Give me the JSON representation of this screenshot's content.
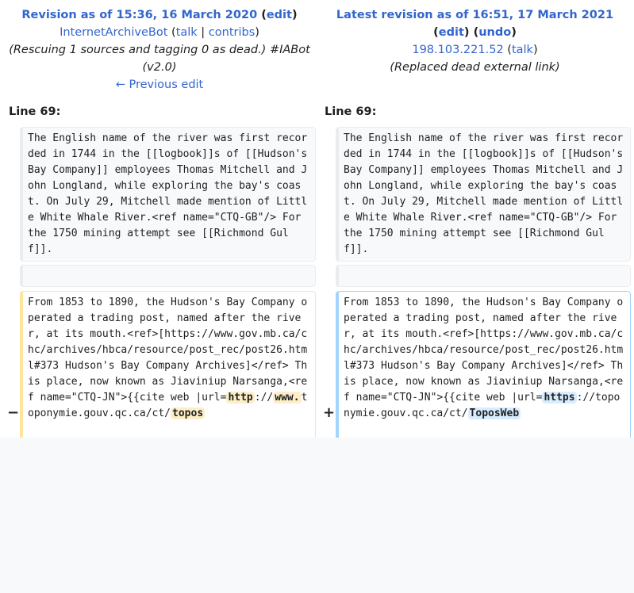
{
  "old_revision": {
    "title": "Revision as of 15:36, 16 March 2020",
    "edit_label": "edit",
    "user": "InternetArchiveBot",
    "talk_label": "talk",
    "contribs_label": "contribs",
    "summary": "(Rescuing 1 sources and tagging 0 as dead.) #IABot (v2.0)",
    "prev_edit_label": "← Previous edit",
    "line_label": "Line 69:"
  },
  "new_revision": {
    "title": "Latest revision as of 16:51, 17 March 2021",
    "edit_label": "edit",
    "undo_label": "undo",
    "user": "198.103.221.52",
    "talk_label": "talk",
    "summary": "(Replaced dead external link)",
    "line_label": "Line 69:"
  },
  "diff": {
    "context_paragraph": "The English name of the river was first recorded in 1744 in the [[logbook]]s of [[Hudson's Bay Company]] employees Thomas Mitchell and John Longland, while exploring the bay's coast. On July 29, Mitchell made mention of Little White Whale River.<ref name=\"CTQ-GB\"/> For the 1750 mining attempt see [[Richmond Gulf]].",
    "deleted_marker": "−",
    "added_marker": "+",
    "old_changed": {
      "prefix": "From 1853 to 1890, the Hudson's Bay Company operated a trading post, named after the river, at its mouth.<ref>[https://www.gov.mb.ca/chc/archives/hbca/resource/post_rec/post26.html#373 Hudson's Bay Company Archives]</ref> This place, now known as Jiaviniup Narsanga,<ref name=\"CTQ-JN\">{{cite web |url=",
      "seg1": "http",
      "mid1": "://",
      "seg2": "www.",
      "mid2": "toponymie.gouv.qc.ca/ct/",
      "seg3": "topos"
    },
    "new_changed": {
      "prefix": "From 1853 to 1890, the Hudson's Bay Company operated a trading post, named after the river, at its mouth.<ref>[https://www.gov.mb.ca/chc/archives/hbca/resource/post_rec/post26.html#373 Hudson's Bay Company Archives]</ref> This place, now known as Jiaviniup Narsanga,<ref name=\"CTQ-JN\">{{cite web |url=",
      "seg1": "https",
      "mid1": "://toponymie.gouv.qc.ca/ct/",
      "seg2": "ToposWeb"
    }
  }
}
